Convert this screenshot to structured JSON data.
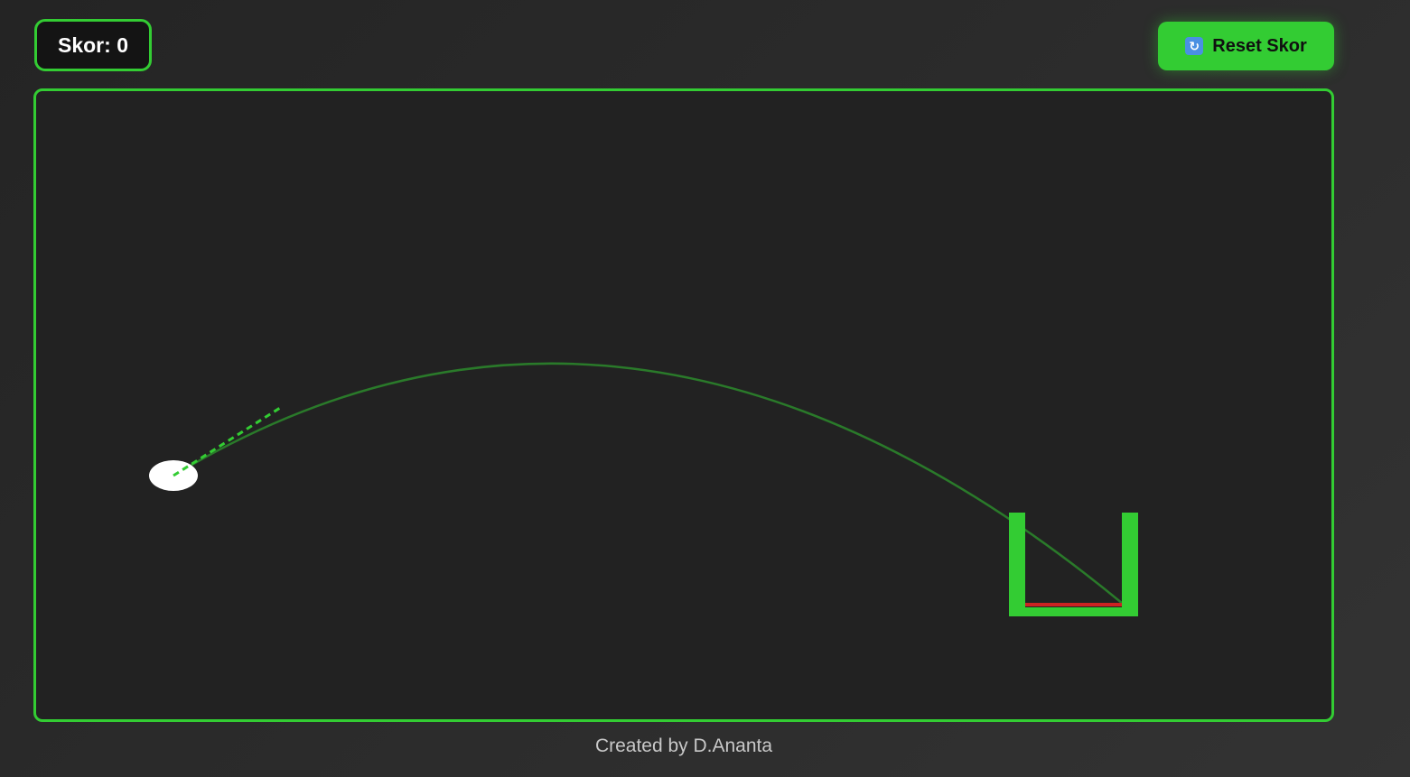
{
  "score": {
    "label": "Skor:",
    "value": "0"
  },
  "reset_button": {
    "icon": "refresh-icon",
    "label": "Reset Skor"
  },
  "footer": {
    "text": "Created by D.Ananta"
  },
  "colors": {
    "accent": "#33cc33",
    "trajectory": "#2a7a2a",
    "background": "#222222",
    "ball": "#ffffff",
    "bucket_floor": "#cc2222"
  }
}
